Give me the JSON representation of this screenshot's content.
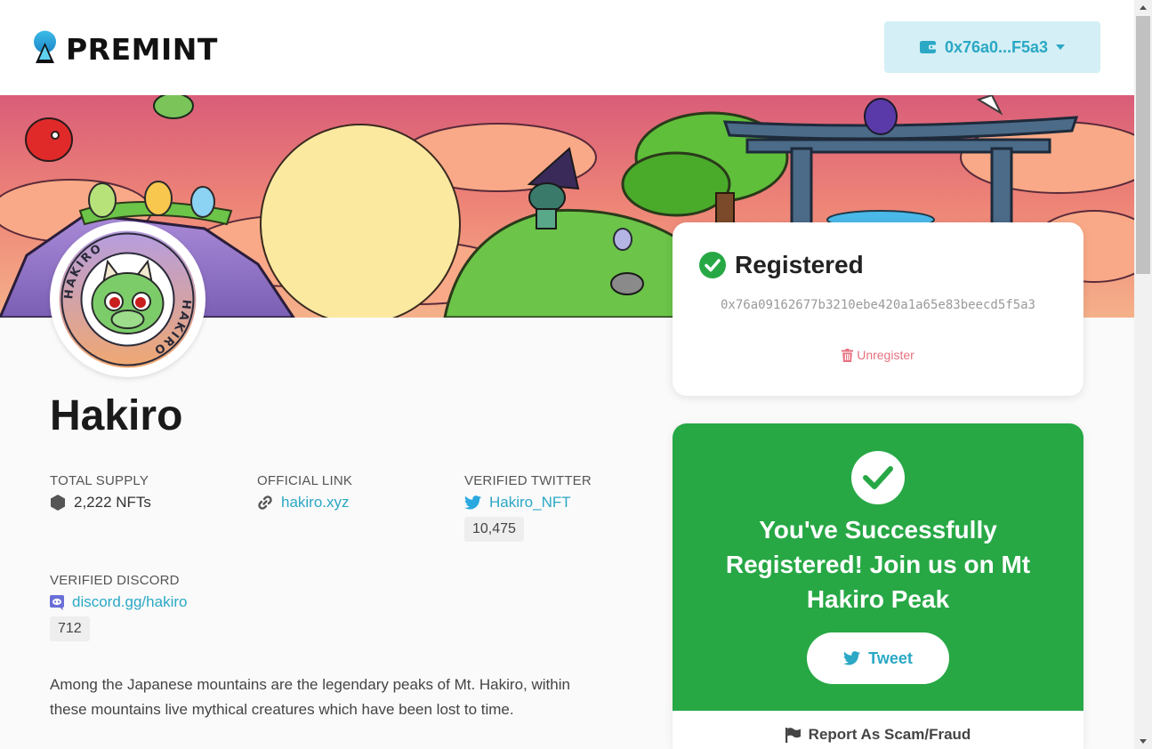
{
  "header": {
    "logo_text": "PREMINT",
    "wallet_label": "0x76a0...F5a3"
  },
  "project": {
    "name": "Hakiro",
    "total_supply_label": "TOTAL SUPPLY",
    "total_supply_value": "2,222 NFTs",
    "official_link_label": "OFFICIAL LINK",
    "official_link_value": "hakiro.xyz",
    "verified_twitter_label": "VERIFIED TWITTER",
    "twitter_handle": "Hakiro_NFT",
    "twitter_count": "10,475",
    "verified_discord_label": "VERIFIED DISCORD",
    "discord_link": "discord.gg/hakiro",
    "discord_count": "712",
    "description": "Among the Japanese mountains are the legendary peaks of Mt. Hakiro, within these mountains live mythical creatures which have been lost to time."
  },
  "registration": {
    "title": "Registered",
    "address": "0x76a09162677b3210ebe420a1a65e83beecd5f5a3",
    "unregister_label": "Unregister"
  },
  "success": {
    "message": "You've Successfully Registered! Join us on Mt Hakiro Peak",
    "tweet_label": "Tweet",
    "report_label": "Report As Scam/Fraud"
  },
  "avatar": {
    "ring_text": "HAKIRO"
  },
  "colors": {
    "accent": "#2aa8c5",
    "success": "#27a845",
    "danger": "#e8707f",
    "wallet_bg": "#d4eff5"
  }
}
